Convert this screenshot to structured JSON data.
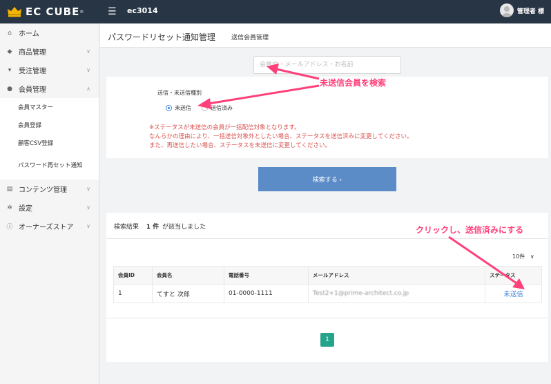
{
  "header": {
    "logo_text": "EC CUBE",
    "logo_reg": "®",
    "shop_name": "ec3014",
    "user_label": "管理者 様"
  },
  "sidebar": {
    "items": [
      {
        "label": "ホーム",
        "icon": "home-icon"
      },
      {
        "label": "商品管理",
        "icon": "tag-icon"
      },
      {
        "label": "受注管理",
        "icon": "cart-icon"
      },
      {
        "label": "会員管理",
        "icon": "users-icon"
      },
      {
        "label": "コンテンツ管理",
        "icon": "file-icon"
      },
      {
        "label": "設定",
        "icon": "gear-icon"
      },
      {
        "label": "オーナーズストア",
        "icon": "info-icon"
      }
    ],
    "sub_items": [
      {
        "label": "会員マスター"
      },
      {
        "label": "会員登録"
      },
      {
        "label": "顧客CSV登録"
      },
      {
        "label": "パスワード再セット通知"
      }
    ]
  },
  "page": {
    "title": "パスワードリセット通知管理",
    "subtitle": "送信会員管理"
  },
  "search": {
    "placeholder": "会員ID・メールアドレス・お名前"
  },
  "filter": {
    "label": "送信・未送信種別",
    "options": [
      {
        "label": "未送信",
        "selected": true
      },
      {
        "label": "送信済み",
        "selected": false
      }
    ],
    "notice": [
      "※ステータスが未送信の会員が一括配信対象となります。",
      "なんらかの理由により、一括送信対象外としたい場合、ステータスを送信済みに変更してください。",
      "また、再送信したい場合、ステータスを未送信に変更してください。"
    ],
    "search_button": "検索する ›"
  },
  "results": {
    "label": "検索結果",
    "count": "1 件",
    "suffix": "が該当しました",
    "per_page": "10件",
    "columns": [
      "会員ID",
      "会員名",
      "電話番号",
      "メールアドレス",
      "ステータス"
    ],
    "rows": [
      {
        "id": "1",
        "name": "てすと 次郎",
        "phone": "01-0000-1111",
        "email": "Test2+1@prime-architect.co.jp",
        "status": "未送信"
      }
    ],
    "page_number": "1"
  },
  "annotations": {
    "search_note": "未送信会員を検索",
    "click_note": "クリックし、送信済みにする",
    "color": "#ff3f7a"
  }
}
